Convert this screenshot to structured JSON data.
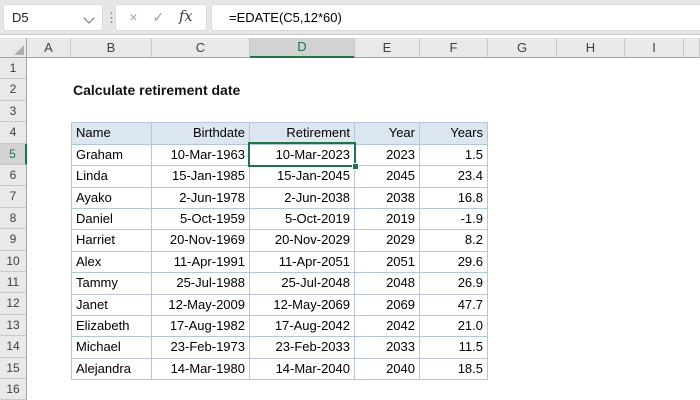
{
  "formula_bar": {
    "cell_reference": "D5",
    "formula": "=EDATE(C5,12*60)",
    "fx_label": "fx",
    "cancel_label": "×",
    "enter_label": "✓",
    "grip_label": "⋮"
  },
  "grid": {
    "column_letters": [
      "A",
      "B",
      "C",
      "D",
      "E",
      "F",
      "G",
      "H",
      "I",
      ""
    ],
    "row_numbers": [
      "1",
      "2",
      "3",
      "4",
      "5",
      "6",
      "7",
      "8",
      "9",
      "10",
      "11",
      "12",
      "13",
      "14",
      "15",
      "16"
    ],
    "selected_column_letter": "D",
    "selected_row_number": "5",
    "active_cell": "D5"
  },
  "sheet": {
    "title": "Calculate retirement date",
    "table": {
      "columns": [
        "Name",
        "Birthdate",
        "Retirement",
        "Year",
        "Years"
      ],
      "rows": [
        [
          "Graham",
          "10-Mar-1963",
          "10-Mar-2023",
          "2023",
          "1.5"
        ],
        [
          "Linda",
          "15-Jan-1985",
          "15-Jan-2045",
          "2045",
          "23.4"
        ],
        [
          "Ayako",
          "2-Jun-1978",
          "2-Jun-2038",
          "2038",
          "16.8"
        ],
        [
          "Daniel",
          "5-Oct-1959",
          "5-Oct-2019",
          "2019",
          "-1.9"
        ],
        [
          "Harriet",
          "20-Nov-1969",
          "20-Nov-2029",
          "2029",
          "8.2"
        ],
        [
          "Alex",
          "11-Apr-1991",
          "11-Apr-2051",
          "2051",
          "29.6"
        ],
        [
          "Tammy",
          "25-Jul-1988",
          "25-Jul-2048",
          "2048",
          "26.9"
        ],
        [
          "Janet",
          "12-May-2009",
          "12-May-2069",
          "2069",
          "47.7"
        ],
        [
          "Elizabeth",
          "17-Aug-1982",
          "17-Aug-2042",
          "2042",
          "21.0"
        ],
        [
          "Michael",
          "23-Feb-1973",
          "23-Feb-2033",
          "2033",
          "11.5"
        ],
        [
          "Alejandra",
          "14-Mar-1980",
          "14-Mar-2040",
          "2040",
          "18.5"
        ]
      ]
    }
  },
  "colors": {
    "selection_green": "#217346",
    "table_header_fill": "#dce6f1",
    "table_border": "#b4c6de",
    "chrome_gray": "#e6e6e6"
  }
}
